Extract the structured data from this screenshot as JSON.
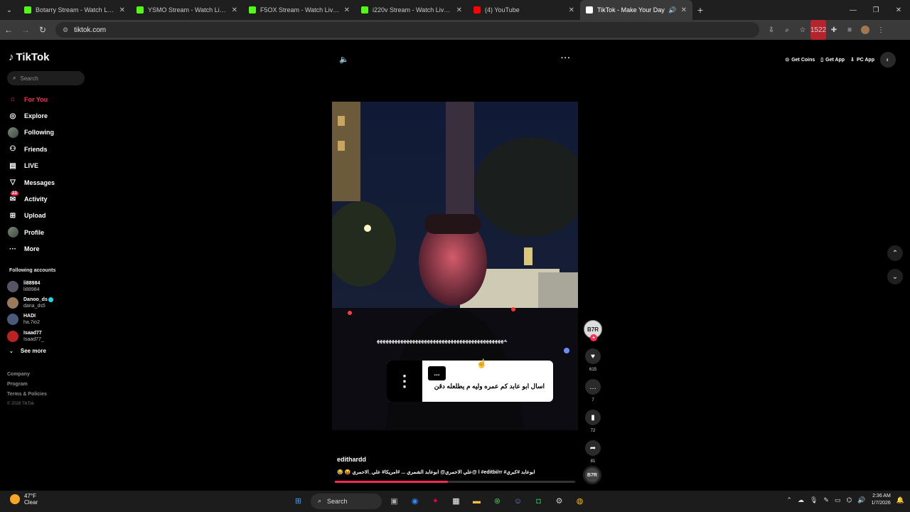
{
  "browser": {
    "tabs": [
      {
        "title": "Botarry Stream - Watch Live on K",
        "color": "#53fc18",
        "active": false
      },
      {
        "title": "YSMO Stream - Watch Live on Ki",
        "color": "#53fc18",
        "active": false
      },
      {
        "title": "F5OX Stream - Watch Live on Kic",
        "color": "#53fc18",
        "active": false
      },
      {
        "title": "i220v Stream - Watch Live on Kic",
        "color": "#53fc18",
        "active": false
      },
      {
        "title": "(4) YouTube",
        "color": "#ff0000",
        "active": false
      },
      {
        "title": "TikTok - Make Your Day",
        "color": "#ffffff",
        "active": true
      }
    ],
    "url": "tiktok.com",
    "ext_badge": "1522"
  },
  "tiktok": {
    "brand": "TikTok",
    "search_placeholder": "Search",
    "nav": [
      {
        "label": "For You",
        "icon": "home-icon"
      },
      {
        "label": "Explore",
        "icon": "compass-icon"
      },
      {
        "label": "Following",
        "icon": "following-avatar-icon"
      },
      {
        "label": "Friends",
        "icon": "friends-icon"
      },
      {
        "label": "LIVE",
        "icon": "live-icon"
      },
      {
        "label": "Messages",
        "icon": "messages-icon"
      },
      {
        "label": "Activity",
        "icon": "activity-icon",
        "badge": "23"
      },
      {
        "label": "Upload",
        "icon": "upload-icon"
      },
      {
        "label": "Profile",
        "icon": "profile-icon"
      },
      {
        "label": "More",
        "icon": "more-icon"
      }
    ],
    "following_title": "Following accounts",
    "following": [
      {
        "user": "li88984",
        "name": "li88984",
        "verified": false,
        "color": "#556"
      },
      {
        "user": "Danoo_ds",
        "name": "dana_ds5",
        "verified": true,
        "color": "#9a7a5a"
      },
      {
        "user": "HADI",
        "name": "ha.7io2",
        "verified": false,
        "color": "#4a5a7a"
      },
      {
        "user": "Isaad77",
        "name": "Isaad77_",
        "verified": false,
        "color": "#b22"
      }
    ],
    "see_more": "See more",
    "footer": [
      "Company",
      "Program",
      "Terms & Policies"
    ],
    "copyright": "© 2026 TikTok",
    "top_actions": [
      {
        "label": "Get Coins",
        "icon": "coin-icon"
      },
      {
        "label": "Get App",
        "icon": "phone-icon"
      },
      {
        "label": "PC App",
        "icon": "download-icon"
      }
    ],
    "video": {
      "overlay_text": "ﻪﻬﻬﻬﻬﻬﻬﻬﻬﻬﻬﻬﻬﻬﻬﻬﻬﻬﻬﻬﻬﻬﻬﻬﻬﻬﻬﻬﻬﻬﻬﻬﻬﻬﻬﻬﻬﻬﻬﻬﻬﻬﻬﻬ",
      "question_tag": "...",
      "question_text": "اسال ابو عابد كم عمره وليه م يطلعله دقن",
      "author": "edithardd",
      "caption": "😂 😝 ا @علي الاحمري@ ابوعابد الشمري ... #امريكا# علي_الاحمري #editbi/rr #ابوعابد #كبري",
      "progress": 0.47
    },
    "creator_avatar": "B7R",
    "stats": {
      "likes": "615",
      "comments": "7",
      "saves": "72",
      "shares": "81"
    }
  },
  "taskbar": {
    "temp": "47°F",
    "condition": "Clear",
    "search": "Search",
    "time": "2:36 AM",
    "date": "1/7/2026"
  }
}
